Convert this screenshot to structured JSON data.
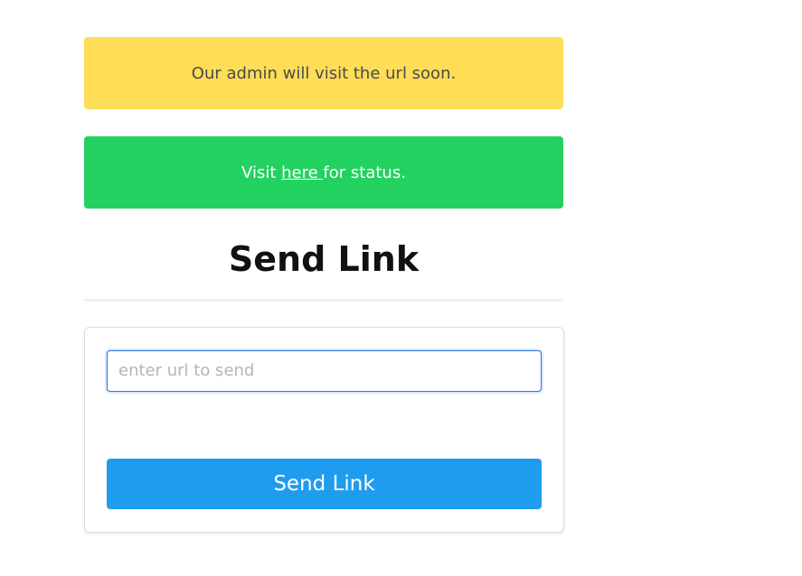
{
  "alerts": {
    "admin_notice": "Our admin will visit the url soon.",
    "status_prefix": "Visit ",
    "status_link": "here ",
    "status_suffix": "for status."
  },
  "page": {
    "title": "Send Link"
  },
  "form": {
    "url_placeholder": "enter url to send",
    "url_value": "",
    "submit_label": "Send Link"
  },
  "colors": {
    "warning": "#ffdd57",
    "success": "#23d160",
    "primary_button": "#209cee",
    "input_focus_border": "#3273dc"
  }
}
